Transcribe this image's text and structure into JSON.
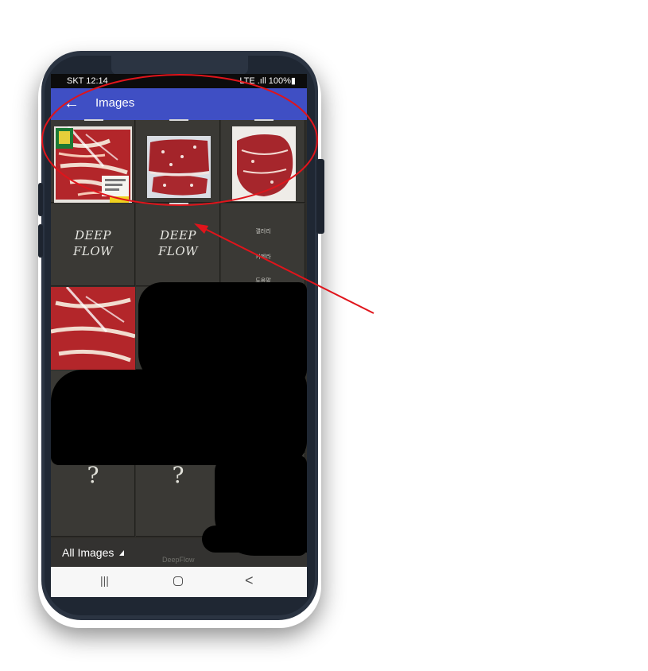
{
  "status_bar": {
    "carrier_time": "SKT 12:14",
    "signal": "LTE .ıll 100%▮"
  },
  "app_bar": {
    "back_icon": "←",
    "title": "Images"
  },
  "grid": {
    "deepflow_logo_line1": "DEEP",
    "deepflow_logo_line2": "FLOW",
    "menu_items": [
      "갤러리",
      "카메라",
      "도움말"
    ],
    "unknown_mark": "?"
  },
  "bottom_tabs": {
    "filter_label": "All Images",
    "deepflow_label": "DeepFlow"
  },
  "nav_bar": {
    "recent": "|||",
    "back": "<"
  },
  "annotation": {
    "circle_color": "#e0141b",
    "arrow_color": "#e0141b"
  },
  "colors": {
    "app_bar": "#3f4fc4",
    "grid_bg": "#2f2e2a",
    "meat_red": "#b3262a"
  }
}
